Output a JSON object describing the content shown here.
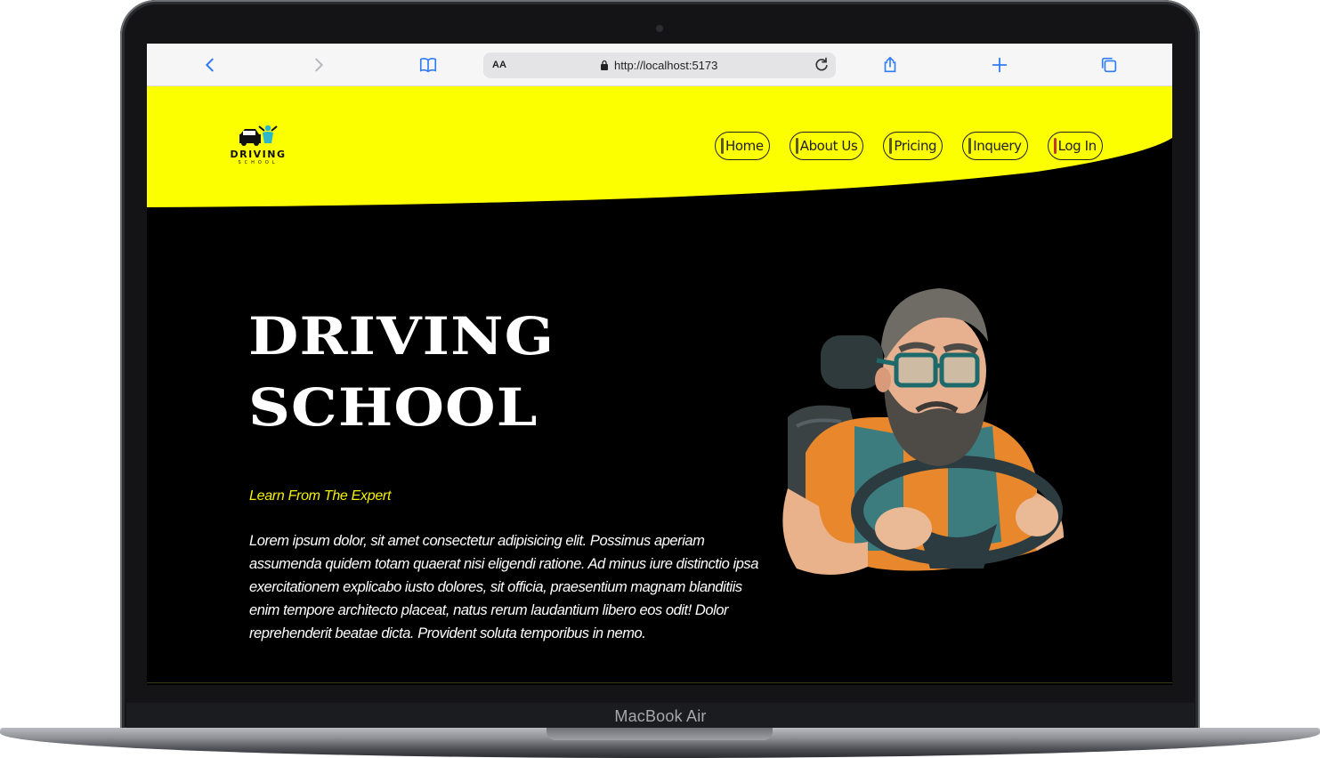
{
  "device": {
    "label": "MacBook Air"
  },
  "browser": {
    "text_size_label": "AA",
    "url": "http://localhost:5173",
    "icons": [
      "back-icon",
      "forward-icon",
      "bookmarks-icon",
      "lock-icon",
      "reload-icon",
      "share-icon",
      "new-tab-icon",
      "tabs-icon"
    ]
  },
  "site": {
    "logo": {
      "word": "DRIVING",
      "sub": "SCHOOL"
    },
    "nav": [
      {
        "label": "Home"
      },
      {
        "label": "About Us"
      },
      {
        "label": "Pricing"
      },
      {
        "label": "Inquery"
      },
      {
        "label": "Log In"
      }
    ],
    "hero": {
      "title_line1": "DRIVING",
      "title_line2": "SCHOOL",
      "tagline": "Learn From The Expert",
      "body": "Lorem ipsum dolor, sit amet consectetur adipisicing elit. Possimus aperiam assumenda quidem totam quaerat nisi eligendi ratione. Ad minus iure distinctio ipsa exercitationem explicabo iusto dolores, sit officia, praesentium magnam blanditiis enim tempore architecto placeat, natus rerum laudantium libero eos odit! Dolor reprehenderit beatae dicta. Provident soluta temporibus in nemo."
    },
    "colors": {
      "accent": "#f5f000",
      "background": "#000000",
      "text": "#ffffff"
    }
  }
}
